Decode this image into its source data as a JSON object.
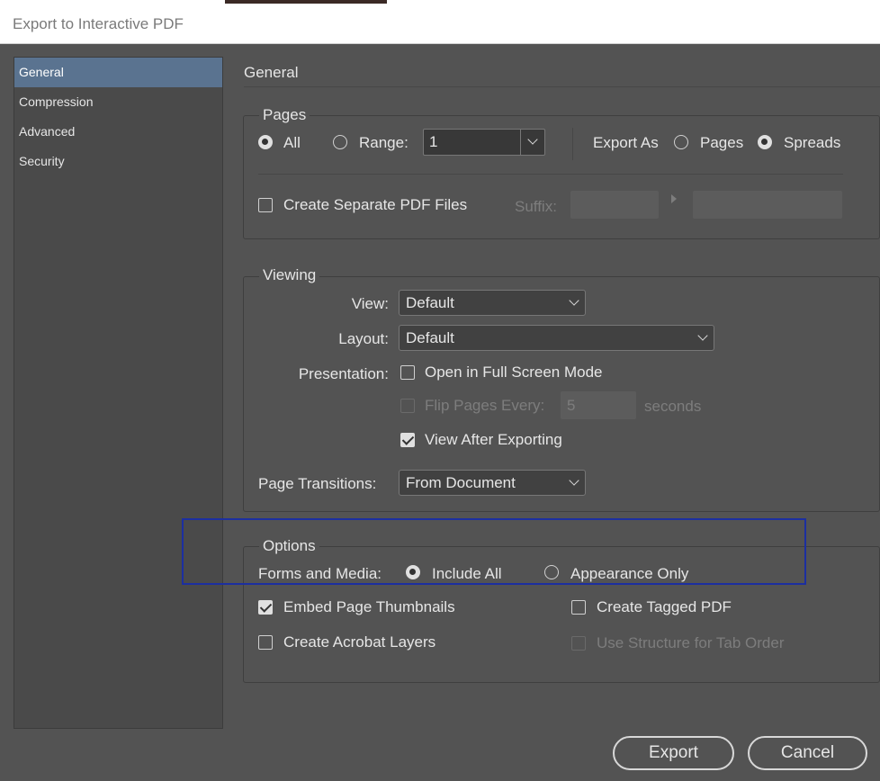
{
  "window": {
    "title": "Export to Interactive PDF"
  },
  "sidebar": {
    "items": [
      {
        "label": "General",
        "selected": true
      },
      {
        "label": "Compression",
        "selected": false
      },
      {
        "label": "Advanced",
        "selected": false
      },
      {
        "label": "Security",
        "selected": false
      }
    ]
  },
  "main": {
    "title": "General"
  },
  "pages": {
    "legend": "Pages",
    "all_label": "All",
    "range_label": "Range:",
    "range_value": "1",
    "export_as_label": "Export As",
    "pages_label": "Pages",
    "spreads_label": "Spreads",
    "separate_label": "Create Separate PDF Files",
    "suffix_label": "Suffix:"
  },
  "viewing": {
    "legend": "Viewing",
    "view_label": "View:",
    "view_value": "Default",
    "layout_label": "Layout:",
    "layout_value": "Default",
    "presentation_label": "Presentation:",
    "fullscreen_label": "Open in Full Screen Mode",
    "flip_label": "Flip Pages Every:",
    "flip_value": "5",
    "seconds_label": "seconds",
    "view_after_label": "View After Exporting",
    "transitions_label": "Page Transitions:",
    "transitions_value": "From Document"
  },
  "options": {
    "legend": "Options",
    "forms_label": "Forms and Media:",
    "include_all_label": "Include All",
    "appearance_only_label": "Appearance Only",
    "embed_thumbnails_label": "Embed Page Thumbnails",
    "acrobat_layers_label": "Create Acrobat Layers",
    "tagged_pdf_label": "Create Tagged PDF",
    "tab_order_label": "Use Structure for Tab Order"
  },
  "footer": {
    "export_label": "Export",
    "cancel_label": "Cancel"
  },
  "colors": {
    "background": "#535353",
    "selection": "#5a7390",
    "highlight": "#1c2fa0"
  }
}
